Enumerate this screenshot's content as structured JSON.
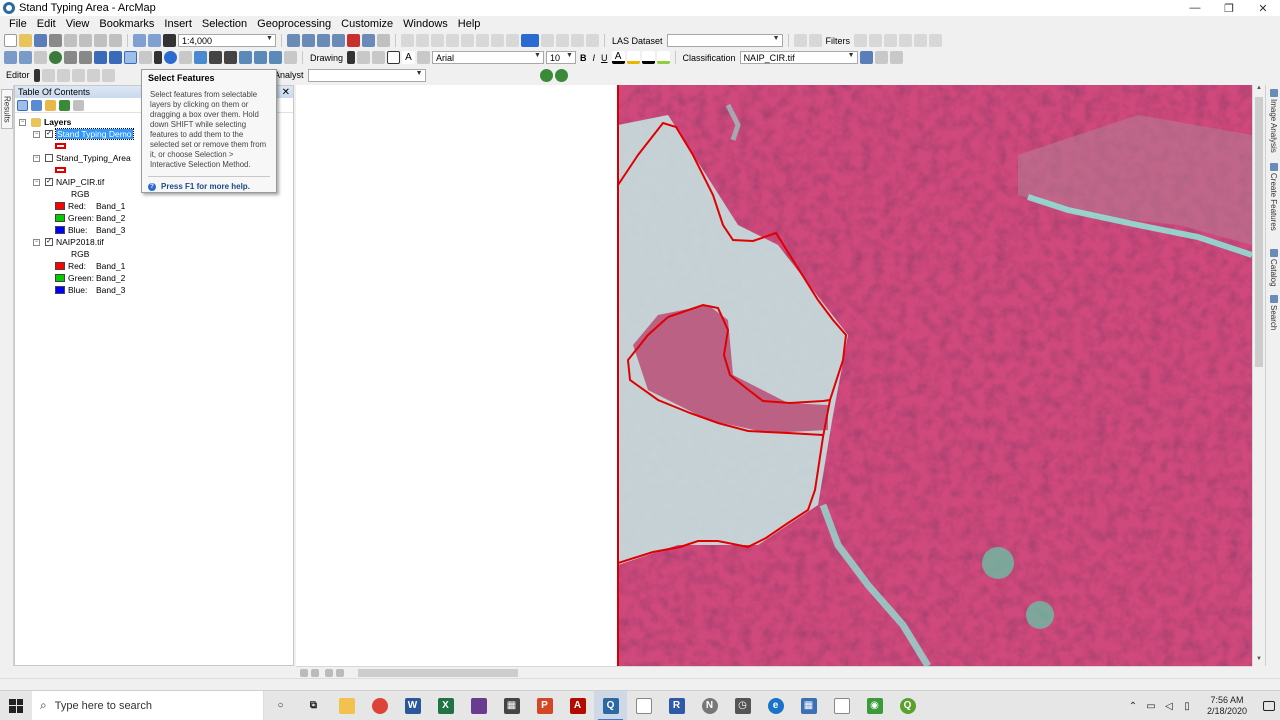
{
  "window": {
    "title": "Stand Typing Area - ArcMap",
    "minimize": "—",
    "restore": "❐",
    "close": "✕"
  },
  "menubar": {
    "items": [
      "File",
      "Edit",
      "View",
      "Bookmarks",
      "Insert",
      "Selection",
      "Geoprocessing",
      "Customize",
      "Windows",
      "Help"
    ]
  },
  "toolbar": {
    "scale": "1:4,000",
    "las_dataset": "LAS Dataset",
    "las_combo": "",
    "filters": "Filters",
    "drawing": "Drawing",
    "font_name": "Arial",
    "font_size": "10",
    "bold": "B",
    "italic": "I",
    "underline": "U",
    "editor": "Editor",
    "analyst_3d": "3D Analyst",
    "classification": "Classification",
    "classification_layer": "NAIP_CIR.tif"
  },
  "left_strip": {
    "tab_label": "Results"
  },
  "toc": {
    "title": "Table Of Contents",
    "close_label": "✕",
    "layers_root": "Layers",
    "layers": [
      {
        "name": "Stand Typing Demo",
        "checked": true,
        "selected": true
      },
      {
        "name": "Stand_Typing_Area",
        "checked": false,
        "selected": false
      },
      {
        "name": "NAIP_CIR.tif",
        "checked": true,
        "rgb": "RGB",
        "bands": [
          {
            "channel": "Red:",
            "band": "Band_1",
            "color": "#ff0000"
          },
          {
            "channel": "Green:",
            "band": "Band_2",
            "color": "#00cc00"
          },
          {
            "channel": "Blue:",
            "band": "Band_3",
            "color": "#0000ff"
          }
        ]
      },
      {
        "name": "NAIP2018.tif",
        "checked": true,
        "rgb": "RGB",
        "bands": [
          {
            "channel": "Red:",
            "band": "Band_1",
            "color": "#ff0000"
          },
          {
            "channel": "Green:",
            "band": "Band_2",
            "color": "#00cc00"
          },
          {
            "channel": "Blue:",
            "band": "Band_3",
            "color": "#0000ff"
          }
        ]
      }
    ]
  },
  "tooltip": {
    "title": "Select Features",
    "body_lines": [
      "Select features from selectable",
      "layers by clicking on them or",
      "dragging a box over them. Hold",
      "down SHIFT while selecting",
      "features to add them to the",
      "selected set or remove them from",
      "it, or choose Selection >",
      "Interactive Selection Method."
    ],
    "help_text": "Press F1 for more help.",
    "help_icon": "?"
  },
  "right_strip": {
    "tabs": [
      "Image Analysis",
      "Create Features",
      "Catalog",
      "Search"
    ]
  },
  "taskbar": {
    "search_placeholder": "Type here to search",
    "time": "7:56 AM",
    "date": "2/18/2020",
    "apps": [
      {
        "name": "cortana",
        "letter": "○",
        "color": "#222222"
      },
      {
        "name": "task-view",
        "letter": "⧉",
        "color": "#222222"
      },
      {
        "name": "file-explorer",
        "letter": "",
        "color": "#f2c14e"
      },
      {
        "name": "chrome",
        "letter": "",
        "color": "#db4437"
      },
      {
        "name": "word",
        "letter": "W",
        "color": "#2b579a"
      },
      {
        "name": "excel",
        "letter": "X",
        "color": "#217346"
      },
      {
        "name": "outlook",
        "letter": "",
        "color": "#6a3c8f"
      },
      {
        "name": "calculator",
        "letter": "▦",
        "color": "#444444"
      },
      {
        "name": "powerpoint",
        "letter": "P",
        "color": "#d24726"
      },
      {
        "name": "acrobat",
        "letter": "A",
        "color": "#b30b00"
      },
      {
        "name": "arcmap",
        "letter": "Q",
        "color": "#2b6aa0"
      },
      {
        "name": "notepad",
        "letter": "",
        "color": "#ffffff"
      },
      {
        "name": "app-blue",
        "letter": "R",
        "color": "#2f5aa8"
      },
      {
        "name": "app-circle",
        "letter": "N",
        "color": "#777777"
      },
      {
        "name": "app-clock",
        "letter": "◷",
        "color": "#555555"
      },
      {
        "name": "app-edge",
        "letter": "e",
        "color": "#1a73c8"
      },
      {
        "name": "app-grid",
        "letter": "▦",
        "color": "#3d6fb5"
      },
      {
        "name": "app-white",
        "letter": "",
        "color": "#ffffff"
      },
      {
        "name": "app-green",
        "letter": "◉",
        "color": "#3b9b3b"
      },
      {
        "name": "qgis",
        "letter": "Q",
        "color": "#5aa02c"
      }
    ]
  },
  "colors": {
    "boundary": "#e00000",
    "selection_highlight": "#3399ff",
    "vegetation": "#d24a7e",
    "open_area": "#bfcfd6",
    "water": "#8ee8d8"
  }
}
